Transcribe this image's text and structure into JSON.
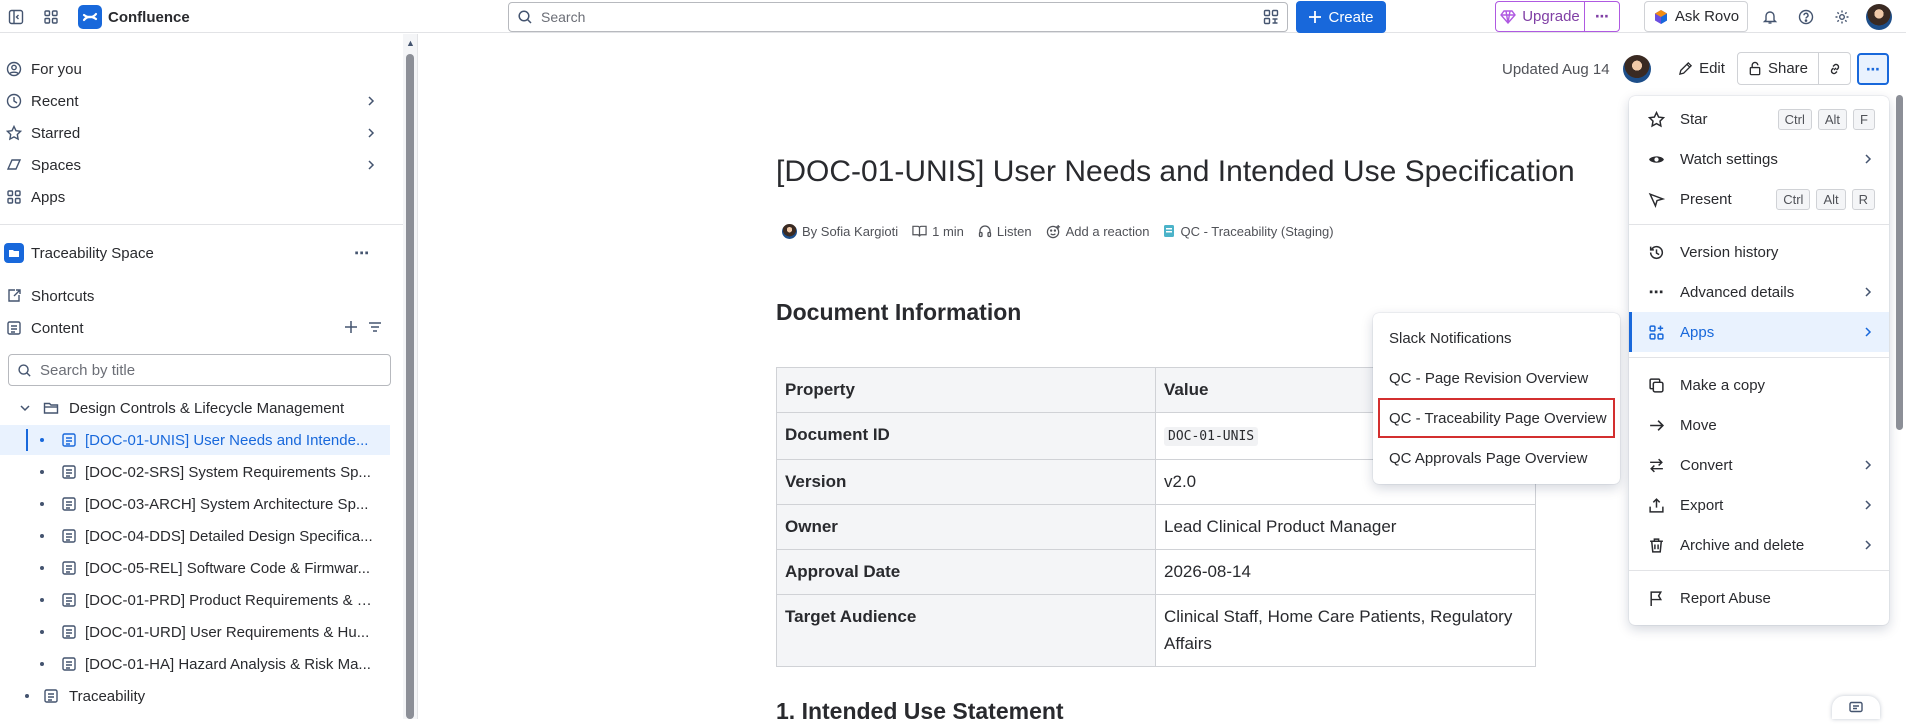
{
  "topbar": {
    "app_name": "Confluence",
    "search_placeholder": "Search",
    "create_label": "Create",
    "upgrade_label": "Upgrade",
    "upgrade_more": "⋯",
    "ask_rovo_label": "Ask Rovo"
  },
  "sidebar": {
    "nav": [
      "For you",
      "Recent",
      "Starred",
      "Spaces",
      "Apps"
    ],
    "space_name": "Traceability Space",
    "shortcuts_label": "Shortcuts",
    "content_label": "Content",
    "search_placeholder": "Search by title",
    "tree": [
      {
        "label": "Design Controls & Lifecycle Management"
      },
      {
        "label": "[DOC-01-UNIS] User Needs and Intende..."
      },
      {
        "label": "[DOC-02-SRS] System Requirements Sp..."
      },
      {
        "label": "[DOC-03-ARCH] System Architecture Sp..."
      },
      {
        "label": "[DOC-04-DDS] Detailed Design Specifica..."
      },
      {
        "label": "[DOC-05-REL] Software Code & Firmwar..."
      },
      {
        "label": "[DOC-01-PRD] Product Requirements & V..."
      },
      {
        "label": "[DOC-01-URD] User Requirements & Hu..."
      },
      {
        "label": "[DOC-01-HA] Hazard Analysis & Risk Ma..."
      },
      {
        "label": "Traceability"
      }
    ]
  },
  "page_header": {
    "updated": "Updated Aug 14",
    "edit_label": "Edit",
    "share_label": "Share"
  },
  "page": {
    "title": "[DOC-01-UNIS] User Needs and Intended Use Specification",
    "byline": {
      "author": "By Sofia Kargioti",
      "read_time": "1 min",
      "listen": "Listen",
      "reaction": "Add a reaction",
      "app": "QC - Traceability (Staging)"
    },
    "section1": "Document Information",
    "table": {
      "headers": [
        "Property",
        "Value"
      ],
      "rows": [
        [
          "Document ID",
          "DOC-01-UNIS"
        ],
        [
          "Version",
          "v2.0"
        ],
        [
          "Owner",
          "Lead Clinical Product Manager"
        ],
        [
          "Approval Date",
          "2026-08-14"
        ],
        [
          "Target Audience",
          "Clinical Staff, Home Care Patients, Regulatory Affairs"
        ]
      ]
    },
    "section2": "1. Intended Use Statement"
  },
  "more_menu": {
    "items": [
      {
        "label": "Star",
        "icon": "star-icon",
        "keys": [
          "Ctrl",
          "Alt",
          "F"
        ]
      },
      {
        "label": "Watch settings",
        "icon": "eye-icon"
      },
      {
        "label": "Present",
        "icon": "present-icon",
        "keys": [
          "Ctrl",
          "Alt",
          "R"
        ]
      },
      {
        "label": "Version history",
        "icon": "history-icon"
      },
      {
        "label": "Advanced details",
        "icon": "more-icon"
      },
      {
        "label": "Apps",
        "icon": "apps-icon"
      },
      {
        "label": "Make a copy",
        "icon": "copy-icon"
      },
      {
        "label": "Move",
        "icon": "arrow-right-icon"
      },
      {
        "label": "Convert",
        "icon": "convert-icon"
      },
      {
        "label": "Export",
        "icon": "export-icon"
      },
      {
        "label": "Archive and delete",
        "icon": "trash-icon"
      },
      {
        "label": "Report Abuse",
        "icon": "flag-icon"
      }
    ]
  },
  "apps_submenu": {
    "items": [
      "Slack Notifications",
      "QC - Page Revision Overview",
      "QC - Traceability Page Overview",
      "QC Approvals Page Overview"
    ]
  },
  "colors": {
    "accent": "#1868db",
    "upgrade": "#af59e1",
    "highlight": "#d32f2f"
  }
}
